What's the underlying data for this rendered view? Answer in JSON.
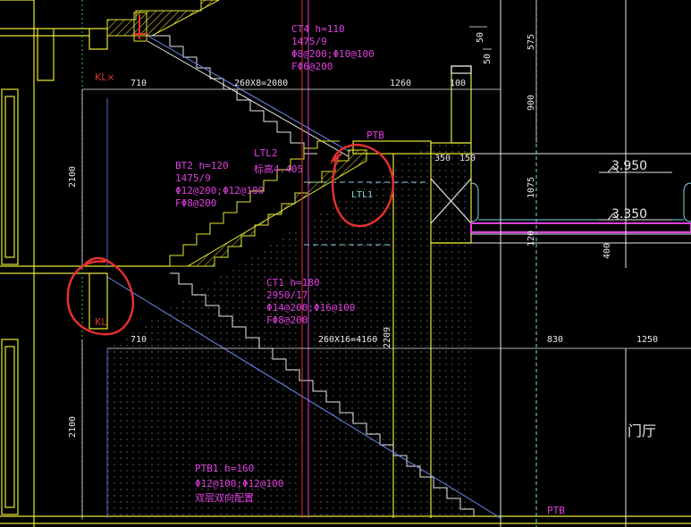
{
  "labels": {
    "kl_top": "KL×",
    "kl_bottom": "KL",
    "ptb_top": "PTB",
    "ptb_bottom": "PTB",
    "ltl2": "LTL2",
    "ltl2_elev": "标高4.405",
    "ltl_circled": "LTL1",
    "door_hall": "门厅"
  },
  "ct4": {
    "title": "CT4 h=110",
    "line2": "1475/9",
    "line3": "Φ8@200;Φ10@100",
    "line4": "FΦ6@200"
  },
  "bt2": {
    "title": "BT2 h=120",
    "line2": "1475/9",
    "line3": "Φ12@200;Φ12@100",
    "line4": "FΦ8@200"
  },
  "ct1": {
    "title": "CT1 h=180",
    "line2": "2950/17",
    "line3": "Φ14@200;Φ16@100",
    "line4": "FΦ8@200"
  },
  "ptb1": {
    "title": "PTB1 h=160",
    "line2": "Φ12@100;Φ12@100",
    "line3": "双层双向配置"
  },
  "dims": {
    "d710_top": "710",
    "d_top_run": "260X8=2080",
    "d1260": "1260",
    "d100": "100",
    "d50a": "50",
    "d50b": "50",
    "d575": "575",
    "d900": "900",
    "d350": "350",
    "d150": "150",
    "d1075": "1075",
    "d120": "120",
    "d400": "400",
    "d2100a": "2100",
    "d2100b": "2100",
    "d710_mid": "710",
    "d_mid_run": "260X16=4160",
    "d2209": "2209",
    "d830": "830",
    "d1250": "1250"
  },
  "elevations": {
    "upper": "3.950",
    "lower": "3.350"
  },
  "colors": {
    "background": "#000000",
    "yellow": "#e6e632",
    "magenta": "#e040e0",
    "red": "#e23030",
    "blue": "#4a6bd8",
    "cyan": "#7fd6e0",
    "dim": "#e8e8e8",
    "green": "#3fc04a"
  }
}
